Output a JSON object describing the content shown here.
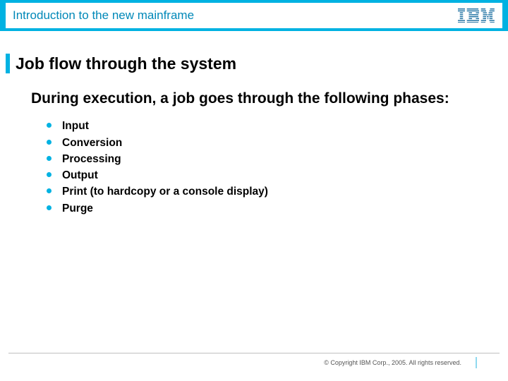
{
  "header": {
    "title": "Introduction to the new mainframe",
    "logo_name": "ibm-logo"
  },
  "slide": {
    "title": "Job flow through the system",
    "lead": "During execution, a job goes through the following phases:",
    "phases": [
      "Input",
      "Conversion",
      "Processing",
      "Output",
      "Print (to hardcopy or a console display)",
      "Purge"
    ]
  },
  "footer": {
    "copyright": "© Copyright IBM Corp., 2005. All rights reserved."
  }
}
